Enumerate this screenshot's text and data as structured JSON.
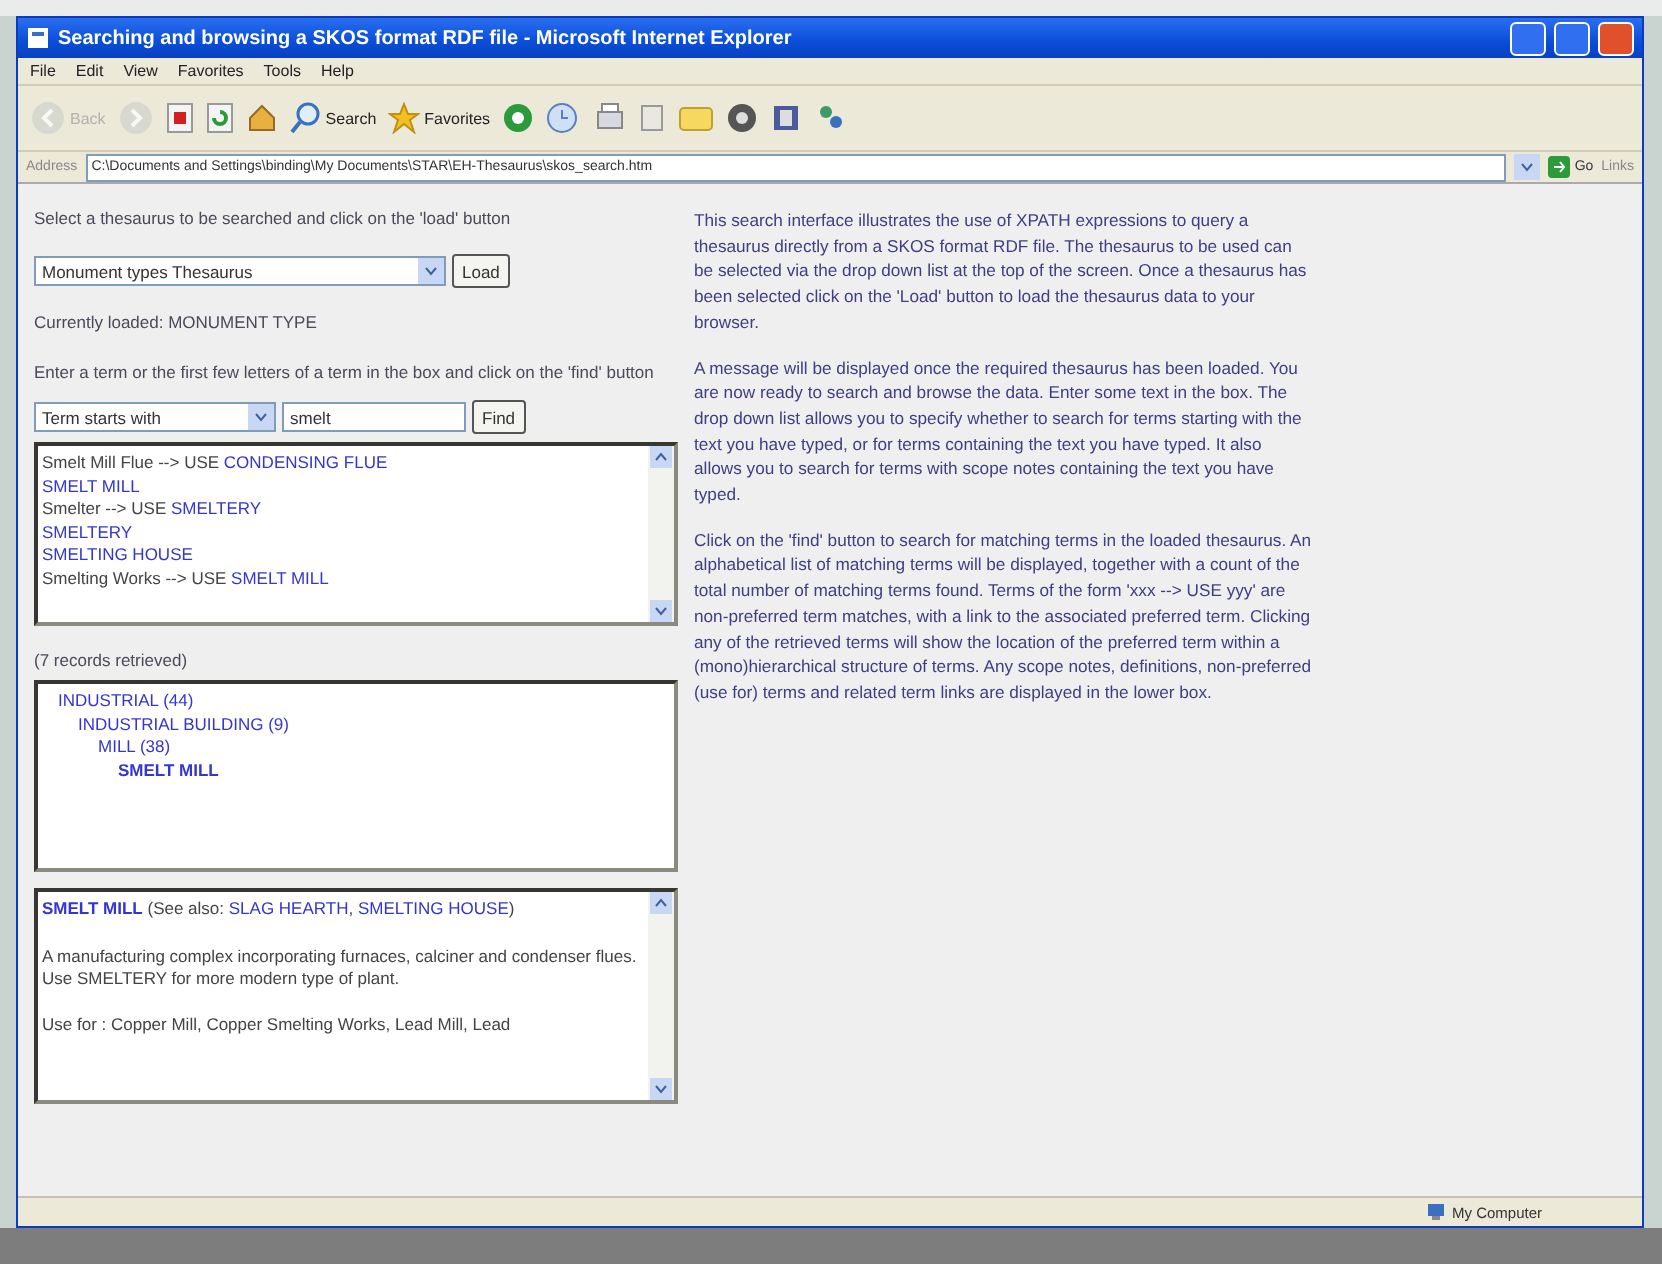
{
  "window": {
    "title": "Searching and browsing a SKOS format RDF file - Microsoft Internet Explorer"
  },
  "menu": [
    "File",
    "Edit",
    "View",
    "Favorites",
    "Tools",
    "Help"
  ],
  "toolbar": [
    {
      "kind": "back",
      "label": "Back",
      "disabled": true
    },
    {
      "kind": "forward",
      "disabled": true
    },
    {
      "kind": "stop",
      "disabled": false
    },
    {
      "kind": "refresh",
      "disabled": false
    },
    {
      "kind": "home",
      "disabled": false
    },
    {
      "kind": "search",
      "label": "Search",
      "disabled": false
    },
    {
      "kind": "favorites",
      "label": "Favorites",
      "disabled": false
    },
    {
      "kind": "media",
      "disabled": false
    },
    {
      "kind": "history",
      "disabled": false
    },
    {
      "kind": "mail",
      "disabled": false
    },
    {
      "kind": "edit",
      "disabled": false
    },
    {
      "kind": "folder",
      "disabled": false
    },
    {
      "kind": "messenger",
      "disabled": false
    },
    {
      "kind": "research",
      "disabled": false
    },
    {
      "kind": "tool",
      "disabled": false
    }
  ],
  "address": {
    "label": "Address",
    "value": "C:\\Documents and Settings\\binding\\My Documents\\STAR\\EH-Thesaurus\\skos_search.htm",
    "go": "Go",
    "links": "Links"
  },
  "left": {
    "instruction_select": "Select a thesaurus to be searched and click on the 'load' button",
    "thesaurus_select": "Monument types Thesaurus",
    "load_button": "Load",
    "loaded_status": "Currently loaded: MONUMENT TYPE",
    "instruction_find": "Enter a term or the first few letters of a term in the box and click on the 'find' button",
    "match_select": "Term starts with",
    "search_value": "smelt",
    "find_button": "Find",
    "results": [
      {
        "kind": "use",
        "text": "Smelt Mill Flue --> USE ",
        "link": "CONDENSING FLUE"
      },
      {
        "kind": "term",
        "link": "SMELT MILL"
      },
      {
        "kind": "use",
        "text": "Smelter --> USE ",
        "link": "SMELTERY"
      },
      {
        "kind": "term",
        "link": "SMELTERY"
      },
      {
        "kind": "term",
        "link": "SMELTING HOUSE"
      },
      {
        "kind": "use",
        "text": "Smelting Works --> USE ",
        "link": "SMELT MILL"
      }
    ],
    "records_count": "(7 records retrieved)",
    "hierarchy": [
      {
        "label": "INDUSTRIAL (44)",
        "selected": false,
        "children": [
          {
            "label": "INDUSTRIAL BUILDING (9)",
            "selected": false,
            "children": [
              {
                "label": "MILL (38)",
                "selected": false,
                "children": [
                  {
                    "label": "SMELT MILL",
                    "selected": true
                  }
                ]
              }
            ]
          }
        ]
      }
    ],
    "details": {
      "term": "SMELT MILL",
      "see_also_open": " (See also: ",
      "see_also": [
        "SLAG HEARTH",
        "SMELTING HOUSE"
      ],
      "see_also_separator": ", ",
      "see_also_close": ")",
      "scope_note": "A manufacturing complex incorporating furnaces, calciner and condenser flues. Use SMELTERY for more modern type of plant.",
      "use_for": "Use for :  Copper Mill, Copper Smelting Works, Lead Mill, Lead"
    }
  },
  "right": [
    "This search interface illustrates the use of XPATH expressions to query a thesaurus directly from a SKOS format RDF file. The thesaurus to be used can be selected via the drop down list at the top of the screen. Once a thesaurus has been selected click on the 'Load' button to load the thesaurus data to your browser.",
    "A message will be displayed once the required thesaurus has been loaded. You are now ready to search and browse the data. Enter some text in the box. The drop down list allows you to specify whether to search for terms starting with the text you have typed, or for terms containing the text you have typed. It also allows you to search for terms with scope notes containing the text you have typed.",
    "Click on the 'find' button to search for matching terms in the loaded thesaurus. An alphabetical list of matching terms will be displayed, together with a count of the total number of matching terms found. Terms of the form 'xxx --> USE yyy' are non-preferred term matches, with a link to the associated preferred term. Clicking any of the retrieved terms will show the location of the preferred term within a (mono)hierarchical structure of terms. Any scope notes, definitions, non-preferred (use for) terms and related term links are displayed in the lower box."
  ],
  "status_bar": {
    "zone": "My Computer"
  }
}
